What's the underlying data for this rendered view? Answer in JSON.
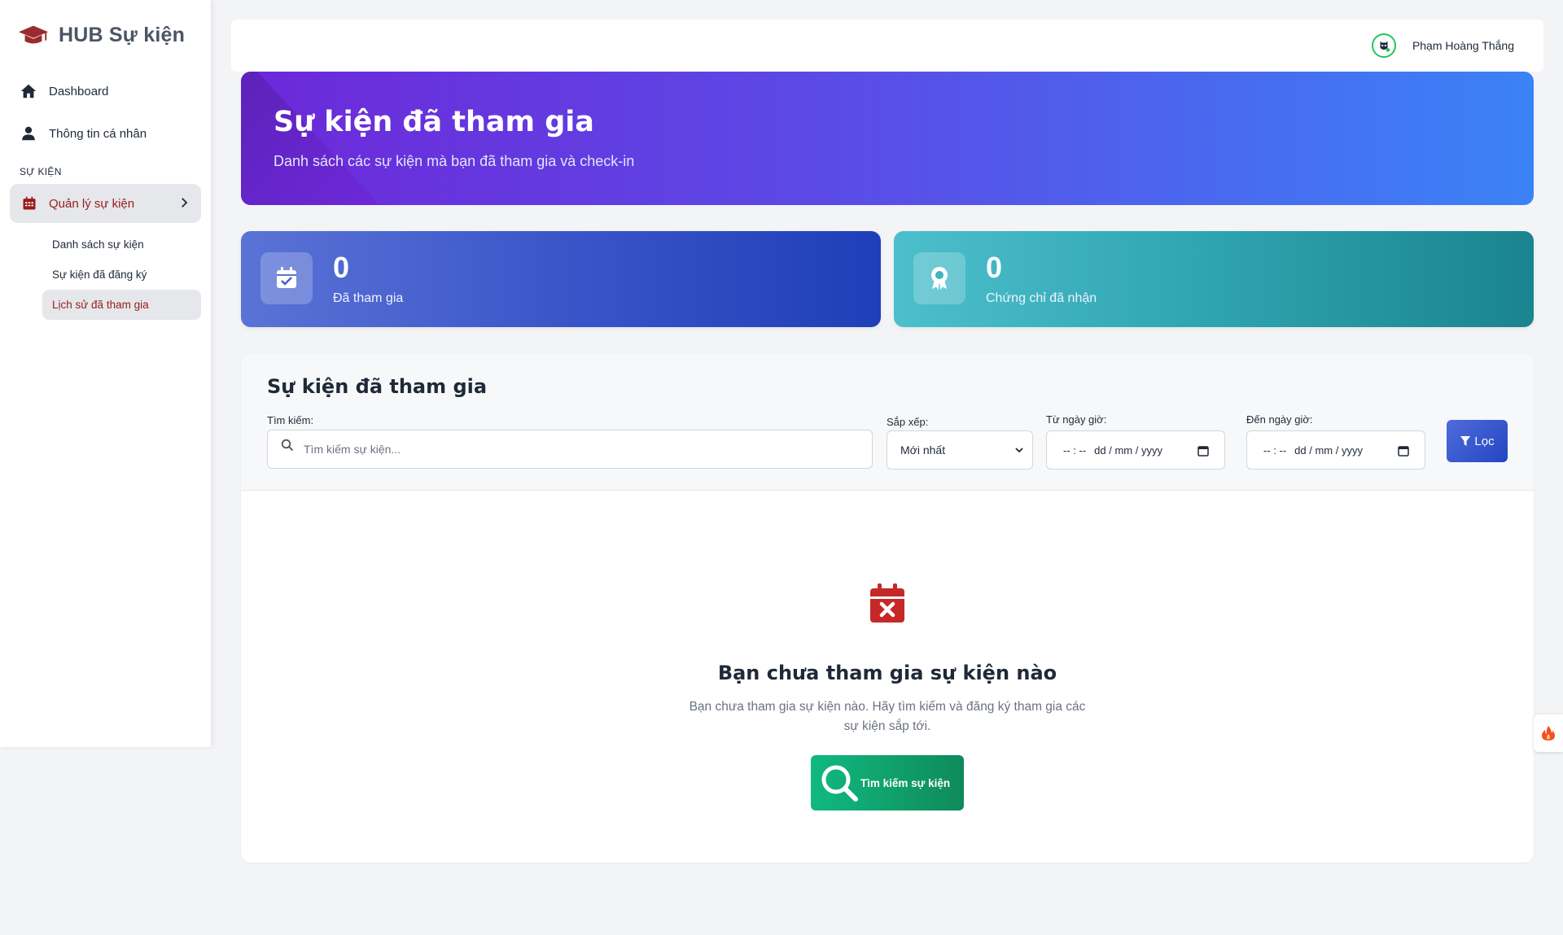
{
  "brand": {
    "name": "HUB Sự kiện",
    "icon": "graduation-cap-icon"
  },
  "sidebar": {
    "items": [
      {
        "label": "Dashboard",
        "icon": "home-icon"
      },
      {
        "label": "Thông tin cá nhân",
        "icon": "user-icon"
      }
    ],
    "section_label": "SỰ KIỆN",
    "active_group": {
      "label": "Quản lý sự kiện",
      "icon": "calendar-icon"
    },
    "sub_items": [
      {
        "label": "Danh sách sự kiện"
      },
      {
        "label": "Sự kiện đã đăng ký"
      },
      {
        "label": "Lịch sử đã tham gia"
      }
    ]
  },
  "topbar": {
    "user_name": "Phạm Hoàng Thắng"
  },
  "hero": {
    "title": "Sự kiện đã tham gia",
    "subtitle": "Danh sách các sự kiện mà bạn đã tham gia và check-in"
  },
  "stats": [
    {
      "value": "0",
      "label": "Đã tham gia",
      "icon": "calendar-check-icon"
    },
    {
      "value": "0",
      "label": "Chứng chỉ đã nhận",
      "icon": "award-icon"
    }
  ],
  "panel": {
    "title": "Sự kiện đã tham gia",
    "search_label": "Tìm kiếm:",
    "search_placeholder": "Tìm kiếm sự kiện...",
    "sort_label": "Sắp xếp:",
    "sort_value": "Mới nhất",
    "from_label": "Từ ngày giờ:",
    "to_label": "Đến ngày giờ:",
    "date_placeholder_time": "-- : --",
    "date_placeholder_date": "dd / mm / yyyy",
    "filter_label": "Lọc"
  },
  "empty_state": {
    "title": "Bạn chưa tham gia sự kiện nào",
    "description": "Bạn chưa tham gia sự kiện nào. Hãy tìm kiếm và đăng ký tham gia các sự kiện sắp tới.",
    "button_label": "Tìm kiếm sự kiện"
  },
  "colors": {
    "accent_red": "#991b1b",
    "hero_start": "#6d28d9",
    "hero_end": "#3b82f6",
    "stat_blue": "#2546c3",
    "stat_teal": "#1a848f",
    "empty_button": "#10b981"
  }
}
